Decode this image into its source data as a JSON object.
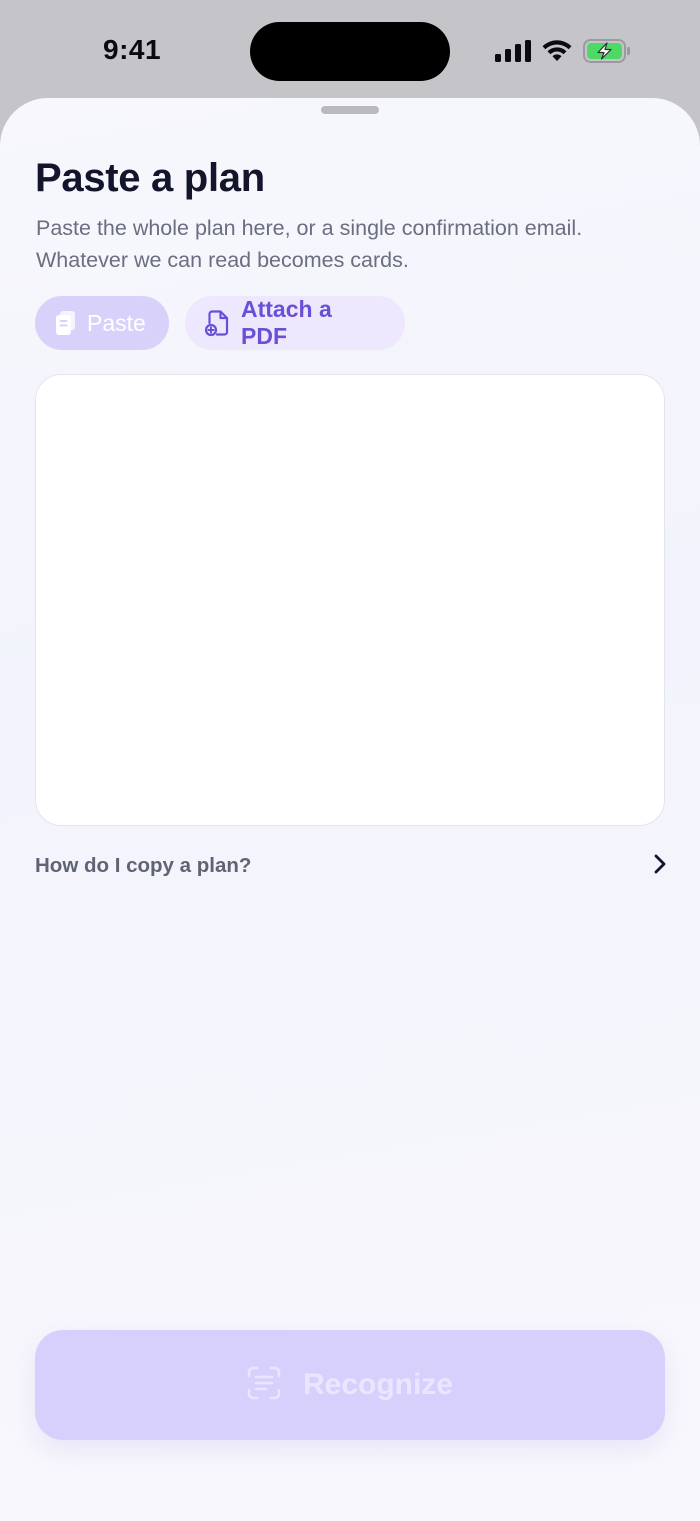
{
  "status_bar": {
    "time": "9:41",
    "icons": [
      "cellular-signal-icon",
      "wifi-icon",
      "battery-charging-icon"
    ]
  },
  "sheet": {
    "title": "Paste a plan",
    "subtitle": "Paste the whole plan here, or a single confirmation email. Whatever we can read becomes cards.",
    "paste_button": {
      "label": "Paste",
      "icon": "clipboard-icon"
    },
    "pdf_button": {
      "label": "Attach a PDF",
      "icon": "document-add-icon"
    },
    "plan_input": {
      "value": "",
      "placeholder": ""
    },
    "help_link": {
      "label": "How do I copy a plan?",
      "icon": "chevron-right-icon"
    },
    "recognize_button": {
      "label": "Recognize",
      "icon": "scan-text-icon"
    }
  },
  "colors": {
    "accent": "#6b4fd6",
    "pill_disabled": "#d8d2fb",
    "pill_secondary": "#ede8fd",
    "recognize_disabled": "#d8d0fc",
    "battery_green": "#4cd964"
  }
}
